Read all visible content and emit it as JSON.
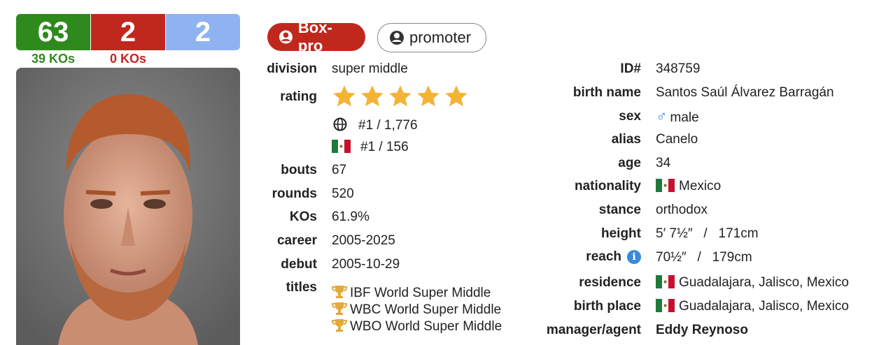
{
  "record": {
    "wins": "63",
    "losses": "2",
    "draws": "2",
    "wins_kos": "39 KOs",
    "losses_kos": "0 KOs"
  },
  "badges": {
    "type": "Box-pro",
    "role": "promoter"
  },
  "left": {
    "division_label": "division",
    "division": "super middle",
    "rating_label": "rating",
    "rating_stars": 5,
    "world_rank": "#1 / 1,776",
    "national_rank": "#1 / 156",
    "bouts_label": "bouts",
    "bouts": "67",
    "rounds_label": "rounds",
    "rounds": "520",
    "kos_label": "KOs",
    "kos": "61.9%",
    "career_label": "career",
    "career": "2005-2025",
    "debut_label": "debut",
    "debut": "2005-10-29",
    "titles_label": "titles",
    "titles": [
      "IBF World Super Middle",
      "WBC World Super Middle",
      "WBO World Super Middle"
    ]
  },
  "right": {
    "id_label": "ID#",
    "id": "348759",
    "birth_name_label": "birth name",
    "birth_name": "Santos Saúl Álvarez Barragán",
    "sex_label": "sex",
    "sex": "male",
    "alias_label": "alias",
    "alias": "Canelo",
    "age_label": "age",
    "age": "34",
    "nationality_label": "nationality",
    "nationality": "Mexico",
    "stance_label": "stance",
    "stance": "orthodox",
    "height_label": "height",
    "height": "5′ 7½″   /   171cm",
    "reach_label": "reach",
    "reach": "70½″   /   179cm",
    "residence_label": "residence",
    "residence": "Guadalajara, Jalisco, Mexico",
    "birth_place_label": "birth place",
    "birth_place": "Guadalajara, Jalisco, Mexico",
    "manager_label": "manager/agent",
    "manager": "Eddy Reynoso"
  },
  "colors": {
    "win": "#2f8a1e",
    "loss": "#c0281e",
    "draw": "#8fb3f0",
    "star": "#f5b335"
  }
}
